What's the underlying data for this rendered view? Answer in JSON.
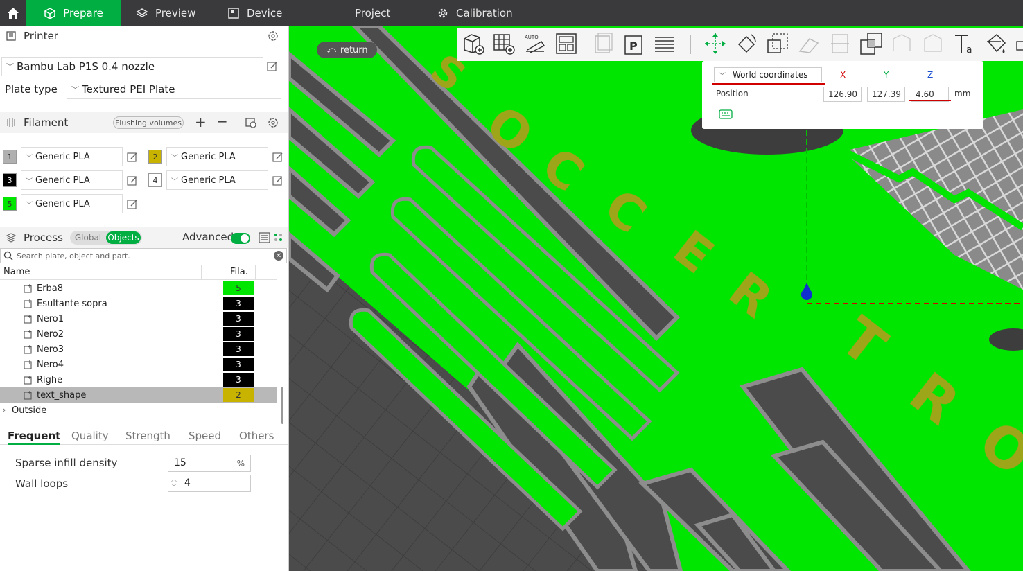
{
  "topbar": {
    "tabs": [
      {
        "label": "Prepare",
        "icon": "cube-icon"
      },
      {
        "label": "Preview",
        "icon": "layers-icon"
      },
      {
        "label": "Device",
        "icon": "device-icon"
      },
      {
        "label": "Project",
        "icon": "project-icon"
      },
      {
        "label": "Calibration",
        "icon": "gear-icon"
      }
    ],
    "active_tab": "Prepare",
    "accent_color": "#00ae42"
  },
  "printer": {
    "section_label": "Printer",
    "printer_name": "Bambu Lab P1S 0.4 nozzle",
    "plate_type_label": "Plate type",
    "plate_type_value": "Textured PEI Plate"
  },
  "filament": {
    "section_label": "Filament",
    "flushing_label": "Flushing volumes",
    "items": [
      {
        "num": "1",
        "name": "Generic PLA",
        "color": "#b0b0b0"
      },
      {
        "num": "2",
        "name": "Generic PLA",
        "color": "#c8b400"
      },
      {
        "num": "3",
        "name": "Generic PLA",
        "color": "#000000"
      },
      {
        "num": "4",
        "name": "Generic PLA",
        "color": "#ffffff"
      },
      {
        "num": "5",
        "name": "Generic PLA",
        "color": "#00e600"
      }
    ]
  },
  "process": {
    "section_label": "Process",
    "global_label": "Global",
    "objects_label": "Objects",
    "advanced_label": "Advanced",
    "search_placeholder": "Search plate, object and part.",
    "col_name": "Name",
    "col_fila": "Fila.",
    "parts": [
      {
        "name": "Erba8",
        "fila": "5",
        "color": "#00e600",
        "text": "#333333"
      },
      {
        "name": "Esultante sopra",
        "fila": "3",
        "color": "#000000",
        "text": "#ffffff"
      },
      {
        "name": "Nero1",
        "fila": "3",
        "color": "#000000",
        "text": "#ffffff"
      },
      {
        "name": "Nero2",
        "fila": "3",
        "color": "#000000",
        "text": "#ffffff"
      },
      {
        "name": "Nero3",
        "fila": "3",
        "color": "#000000",
        "text": "#ffffff"
      },
      {
        "name": "Nero4",
        "fila": "3",
        "color": "#000000",
        "text": "#ffffff"
      },
      {
        "name": "Righe",
        "fila": "3",
        "color": "#000000",
        "text": "#ffffff"
      },
      {
        "name": "text_shape",
        "fila": "2",
        "color": "#c8b400",
        "text": "#333333"
      }
    ],
    "outside_label": "Outside",
    "settings_tabs": [
      "Frequent",
      "Quality",
      "Strength",
      "Speed",
      "Others"
    ],
    "sparse_infill_label": "Sparse infill density",
    "sparse_infill_value": "15",
    "sparse_infill_unit": "%",
    "wall_loops_label": "Wall loops",
    "wall_loops_value": "4"
  },
  "viewport": {
    "return_label": "return",
    "coord_mode": "World coordinates",
    "x_label": "X",
    "y_label": "Y",
    "z_label": "Z",
    "position_label": "Position",
    "pos_x": "126.90",
    "pos_y": "127.39",
    "pos_z": "4.60",
    "unit": "mm"
  }
}
